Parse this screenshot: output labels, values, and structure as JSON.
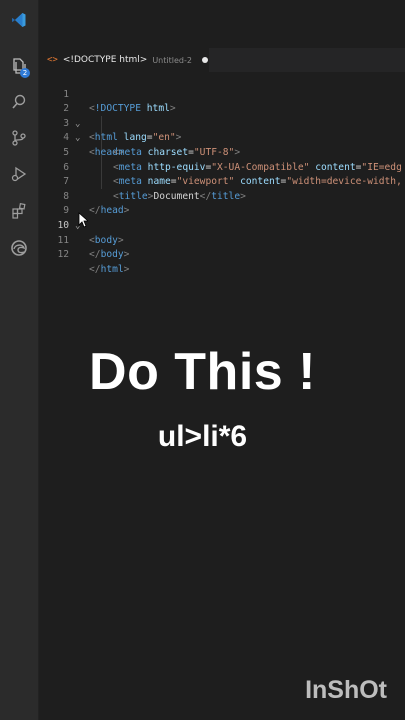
{
  "activity_bar": {
    "items": [
      {
        "icon": "explorer-icon",
        "badge": "2"
      },
      {
        "icon": "search-icon"
      },
      {
        "icon": "source-control-icon"
      },
      {
        "icon": "run-debug-icon"
      },
      {
        "icon": "extensions-icon"
      },
      {
        "icon": "edge-browser-icon"
      }
    ]
  },
  "tab": {
    "icon": "<>",
    "title": "<!DOCTYPE html>",
    "subtitle": "Untitled-2",
    "modified": true
  },
  "editor": {
    "line_numbers": [
      "1",
      "2",
      "3",
      "4",
      "5",
      "6",
      "7",
      "8",
      "9",
      "10",
      "11",
      "12"
    ],
    "lines": [
      "<!DOCTYPE html>",
      "<html lang=\"en\">",
      "<head>",
      "<meta charset=\"UTF-8\">",
      "<meta http-equiv=\"X-UA-Compatible\" content=\"IE=edg",
      "<meta name=\"viewport\" content=\"width=device-width,",
      "<title>Document</title>",
      "</head>",
      "<body>",
      "",
      "</body>",
      "</html>"
    ]
  },
  "overlay": {
    "title": "Do This !",
    "subtitle": "ul>li*6"
  },
  "watermark": "InShOt",
  "colors": {
    "background": "#1e1e1e",
    "activity_bar": "#2b2b2b",
    "tag": "#569cd6",
    "attribute": "#9cdcfe",
    "string": "#ce9178",
    "bracket": "#808080",
    "accent": "#2f7ad6"
  }
}
